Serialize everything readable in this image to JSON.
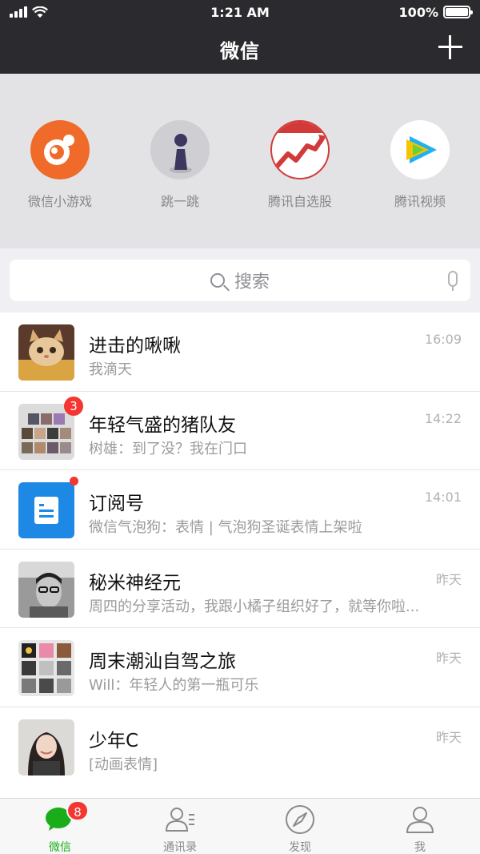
{
  "status_bar": {
    "time": "1:21 AM",
    "battery": "100%"
  },
  "header": {
    "title": "微信"
  },
  "mini_programs": [
    {
      "label": "微信小游戏",
      "icon": "game-icon"
    },
    {
      "label": "跳一跳",
      "icon": "jump-piece-icon"
    },
    {
      "label": "腾讯自选股",
      "icon": "stock-chart-icon"
    },
    {
      "label": "腾讯视频",
      "icon": "video-play-icon"
    }
  ],
  "search": {
    "placeholder": "搜索"
  },
  "chats": [
    {
      "name": "进击的啾啾",
      "message": "我滴天",
      "time": "16:09"
    },
    {
      "name": "年轻气盛的猪队友",
      "message": "树雄：到了没？我在门口",
      "time": "14:22",
      "badge": "3"
    },
    {
      "name": "订阅号",
      "message": "微信气泡狗：表情 | 气泡狗圣诞表情上架啦",
      "time": "14:01"
    },
    {
      "name": "秘米神经元",
      "message": "周四的分享活动，我跟小橘子组织好了，就等你啦...",
      "time": "昨天"
    },
    {
      "name": "周末潮汕自驾之旅",
      "message": "Will：年轻人的第一瓶可乐",
      "time": "昨天"
    },
    {
      "name": "少年C",
      "message": "[动画表情]",
      "time": "昨天"
    }
  ],
  "tabbar": {
    "tabs": [
      {
        "label": "微信",
        "badge": "8"
      },
      {
        "label": "通讯录"
      },
      {
        "label": "发现"
      },
      {
        "label": "我"
      }
    ]
  },
  "colors": {
    "accent": "#1aad19",
    "badge": "#f43530",
    "header": "#2b2b2f"
  }
}
